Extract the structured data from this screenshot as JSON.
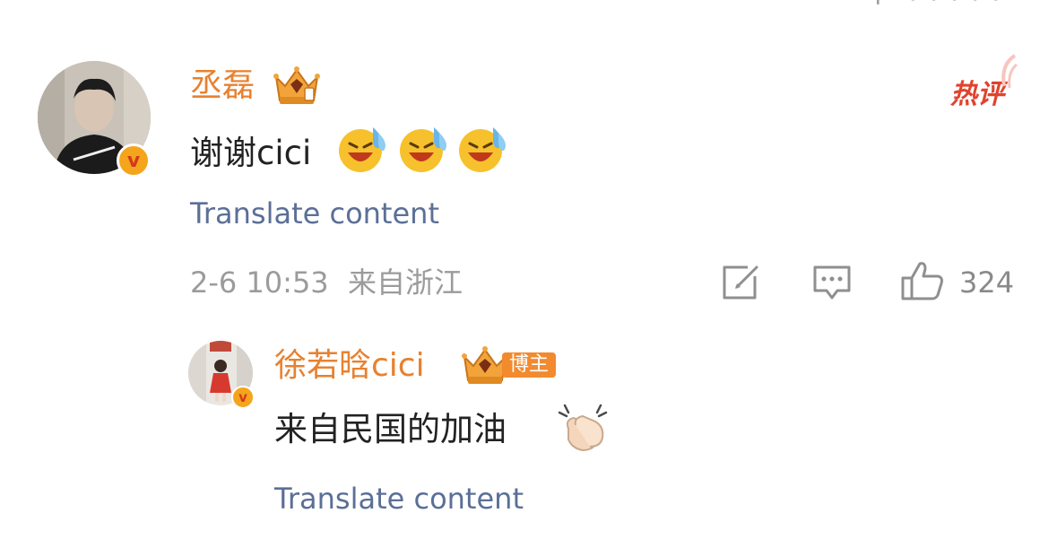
{
  "comment": {
    "username": "丞磊",
    "text": "谢谢cici",
    "hot_label": "热评",
    "translate_label": "Translate content",
    "timestamp": "2-6 10:53",
    "location": "来自浙江",
    "like_count": "324",
    "emojis": [
      "laugh-cry-emoji",
      "laugh-cry-emoji",
      "laugh-cry-emoji"
    ]
  },
  "reply": {
    "username": "徐若晗cici",
    "author_tag": "博主",
    "text": "来自民国的加油",
    "emoji": "clapping-hands-emoji",
    "translate_label": "Translate content"
  },
  "colors": {
    "username": "#e8812f",
    "translate": "#5b6f97",
    "meta": "#9b9b9b",
    "hot": "#e0432e",
    "verified_badge": "#f4a51c"
  }
}
